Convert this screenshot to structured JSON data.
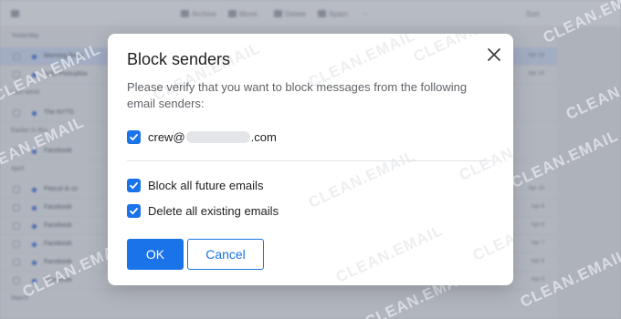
{
  "watermark": "CLEAN.EMAIL",
  "background": {
    "toolbar": [
      "Archive",
      "Move",
      "Delete",
      "Spam",
      "···"
    ],
    "sort_label": "Sort",
    "sections": [
      {
        "label": "Yesterday",
        "rows": [
          {
            "sender": "Morning Brew",
            "date": "Apr 14",
            "selected": true
          },
          {
            "sender": "Julia Portnykhe",
            "date": "Apr 14",
            "selected": false
          }
        ]
      },
      {
        "label": "Last week",
        "rows": [
          {
            "sender": "The NYTS",
            "date": "",
            "selected": false
          }
        ]
      },
      {
        "label": "Earlier in this",
        "rows": [
          {
            "sender": "Facebook",
            "date": "",
            "selected": false
          }
        ]
      },
      {
        "label": "April",
        "rows": [
          {
            "sender": "Pascal & co",
            "date": "Apr 10",
            "selected": false
          },
          {
            "sender": "Facebook",
            "date": "Apr 9",
            "selected": false
          },
          {
            "sender": "Facebook",
            "date": "Apr 8",
            "selected": false
          },
          {
            "sender": "Facebook",
            "date": "Apr 7",
            "selected": false
          },
          {
            "sender": "Facebook",
            "date": "Apr 6",
            "selected": false
          },
          {
            "sender": "Facebook",
            "date": "Apr 5",
            "selected": false
          }
        ]
      },
      {
        "label": "March",
        "rows": []
      }
    ]
  },
  "dialog": {
    "title": "Block senders",
    "description": "Please verify that you want to block messages from the following email senders:",
    "sender": {
      "local": "crew@",
      "domain": ".com",
      "checked": true
    },
    "options": [
      {
        "label": "Block all future emails",
        "checked": true
      },
      {
        "label": "Delete all existing emails",
        "checked": true
      }
    ],
    "ok_label": "OK",
    "cancel_label": "Cancel"
  },
  "colors": {
    "accent": "#1a73e8",
    "text": "#202124",
    "muted": "#5f6368"
  }
}
